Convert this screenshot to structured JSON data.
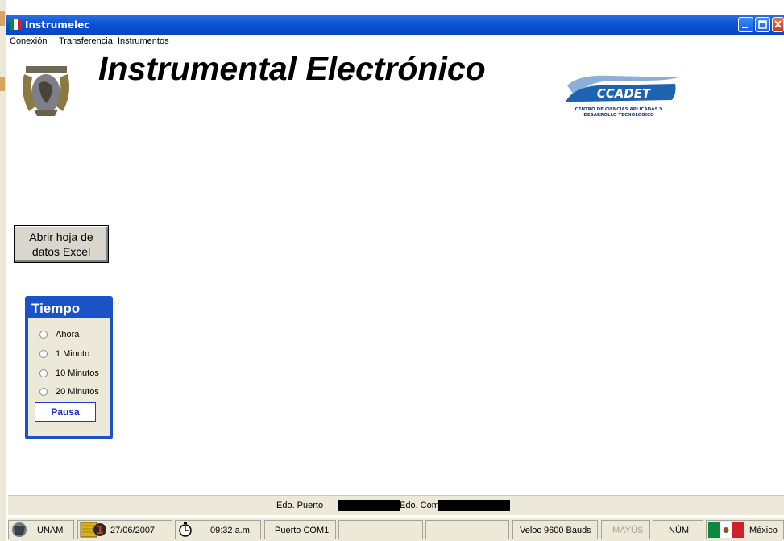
{
  "window": {
    "title": "Instrumelec"
  },
  "menu": [
    "Conexión",
    "Transferencia",
    "Instrumentos"
  ],
  "header": {
    "title": "Instrumental  Electrónico",
    "ccadet": {
      "name": "CCADET",
      "line1": "CENTRO DE CIENCIAS APLICADAS Y",
      "line2": "DESARROLLO TECNOLOGICO"
    }
  },
  "excel_button": {
    "line1": "Abrir hoja de",
    "line2": "datos Excel"
  },
  "tiempo": {
    "title": "Tiempo",
    "options": [
      "Ahora",
      "1 Minuto",
      "10 Minutos",
      "20 Minutos"
    ],
    "pause_label": "Pausa"
  },
  "status": {
    "edo_puerto_label": "Edo. Puerto",
    "edo_com_label": "Edo. Com",
    "unam": "UNAM",
    "date": "27/06/2007",
    "calendar_day": "1",
    "time": "09:32 a.m.",
    "port": "Puerto  COM1",
    "speed": "Veloc  9600 Bauds",
    "caps": "MAYÚS",
    "num": "NÚM",
    "country": "México"
  },
  "colors": {
    "titlebar": "#0a53d4",
    "tiempo_panel": "#1a52c8",
    "ccadet_blue": "#1e63b0"
  }
}
